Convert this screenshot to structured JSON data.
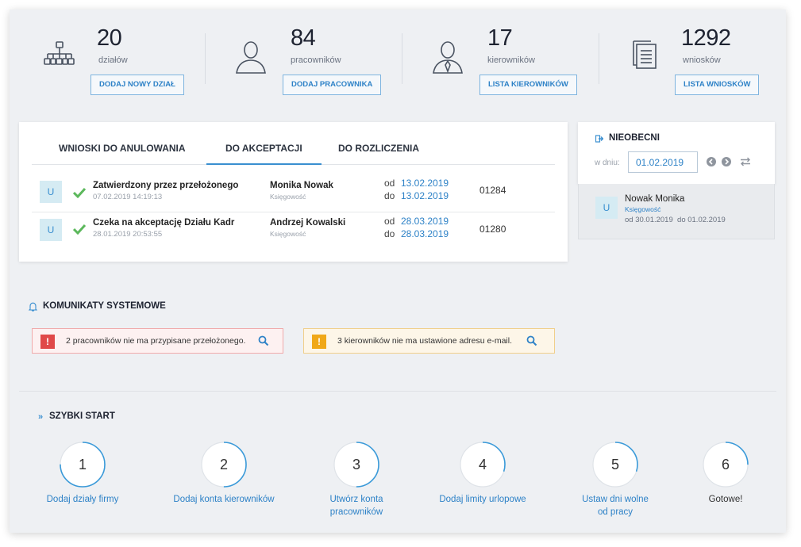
{
  "stats": [
    {
      "value": "20",
      "label": "działów",
      "button": "DODAJ NOWY DZIAŁ",
      "icon": "org-chart-icon"
    },
    {
      "value": "84",
      "label": "pracowników",
      "button": "DODAJ PRACOWNIKA",
      "icon": "user-icon"
    },
    {
      "value": "17",
      "label": "kierowników",
      "button": "LISTA KIEROWNIKÓW",
      "icon": "manager-icon"
    },
    {
      "value": "1292",
      "label": "wniosków",
      "button": "LISTA WNIOSKÓW",
      "icon": "documents-icon"
    }
  ],
  "requests": {
    "tabs": [
      "WNIOSKI DO ANULOWANIA",
      "DO AKCEPTACJI",
      "DO ROZLICZENIA"
    ],
    "active_tab": 1,
    "rows": [
      {
        "avatar": "U",
        "status": "Zatwierdzony przez przełożonego",
        "timestamp": "07.02.2019 14:19:13",
        "name": "Monika Nowak",
        "department": "Księgowość",
        "from_prefix": "od",
        "from": "13.02.2019",
        "to_prefix": "do",
        "to": "13.02.2019",
        "number": "01284"
      },
      {
        "avatar": "U",
        "status": "Czeka na akceptację Działu Kadr",
        "timestamp": "28.01.2019 20:53:55",
        "name": "Andrzej Kowalski",
        "department": "Księgowość",
        "from_prefix": "od",
        "from": "28.03.2019",
        "to_prefix": "do",
        "to": "28.03.2019",
        "number": "01280"
      }
    ]
  },
  "absent": {
    "title": "NIEOBECNI",
    "date_label": "w dniu:",
    "date_value": "01.02.2019",
    "person": {
      "avatar": "U",
      "name": "Nowak Monika",
      "department": "Księgowość",
      "range": "od 30.01.2019  do 01.02.2019"
    }
  },
  "messages": {
    "title": "KOMUNIKATY SYSTEMOWE",
    "items": [
      {
        "text": "2 pracowników nie ma przypisane przełożonego.",
        "badge": "!",
        "color": "#e04848",
        "bg": "#fdf1f1",
        "border": "#f0aaaa"
      },
      {
        "text": "3 kierowników nie ma ustawione adresu e-mail.",
        "badge": "!",
        "color": "#f0a818",
        "bg": "#fdf6e8",
        "border": "#f0cf8a"
      }
    ]
  },
  "quick_start": {
    "title": "SZYBKI START",
    "steps": [
      {
        "n": "1",
        "label_lines": [
          "Dodaj działy firmy"
        ],
        "progress": 0.75
      },
      {
        "n": "2",
        "label_lines": [
          "Dodaj konta kierowników"
        ],
        "progress": 0.5
      },
      {
        "n": "3",
        "label_lines": [
          "Utwórz konta",
          "pracowników"
        ],
        "progress": 0.5
      },
      {
        "n": "4",
        "label_lines": [
          "Dodaj limity urlopowe"
        ],
        "progress": 0.3
      },
      {
        "n": "5",
        "label_lines": [
          "Ustaw dni wolne",
          "od pracy"
        ],
        "progress": 0.3
      },
      {
        "n": "6",
        "label_lines": [
          "Gotowe!"
        ],
        "progress": 0.25
      }
    ]
  },
  "colors": {
    "accent": "#2e82c7",
    "ok": "#5cb85c",
    "ring": "#3a9ad9"
  }
}
